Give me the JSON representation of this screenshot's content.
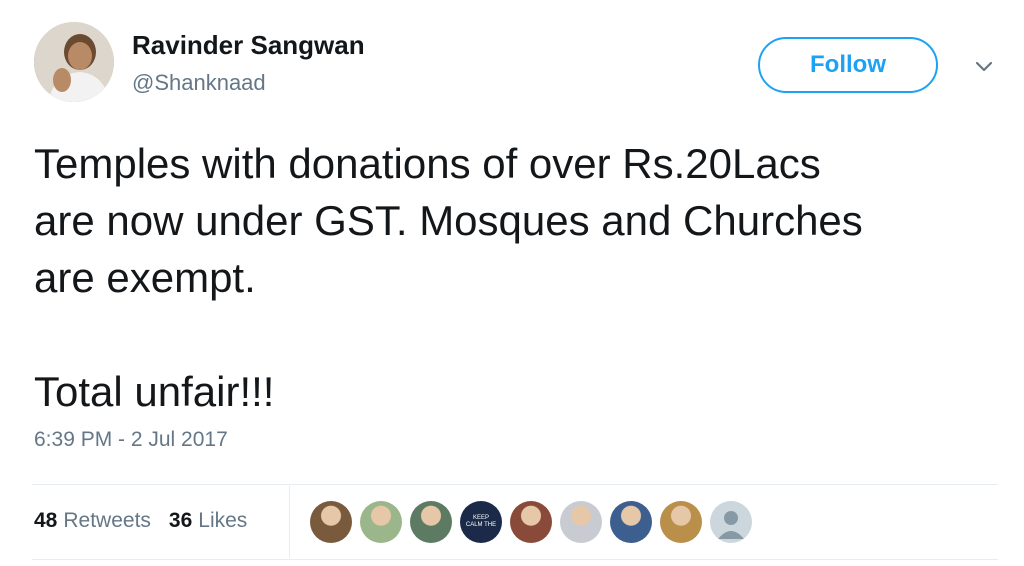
{
  "author": {
    "name": "Ravinder Sangwan",
    "handle": "@Shanknaad"
  },
  "follow_label": "Follow",
  "tweet": {
    "lines": [
      "Temples with donations of over Rs.20Lacs",
      "are now under GST. Mosques and Churches",
      "are exempt."
    ],
    "closing": "Total unfair!!!",
    "timestamp": "6:39 PM - 2 Jul 2017"
  },
  "stats": {
    "retweets_count": "48",
    "retweets_label": "Retweets",
    "likes_count": "36",
    "likes_label": "Likes"
  },
  "likers": [
    {
      "name": "liker-avatar-1",
      "color": "#7a5a3c"
    },
    {
      "name": "liker-avatar-2",
      "color": "#9bb68a"
    },
    {
      "name": "liker-avatar-3",
      "color": "#5d7a63"
    },
    {
      "name": "liker-avatar-4",
      "color": "#1c2a4a",
      "text": "KEEP CALM THE"
    },
    {
      "name": "liker-avatar-5",
      "color": "#8a4a3a"
    },
    {
      "name": "liker-avatar-6",
      "color": "#c9cbd2"
    },
    {
      "name": "liker-avatar-7",
      "color": "#3d5f8f"
    },
    {
      "name": "liker-avatar-8",
      "color": "#b98f4a"
    },
    {
      "name": "liker-avatar-9",
      "color": "#ccd6dd"
    }
  ],
  "colors": {
    "accent": "#1da1f2",
    "secondary_text": "#657786",
    "primary_text": "#14171a"
  }
}
